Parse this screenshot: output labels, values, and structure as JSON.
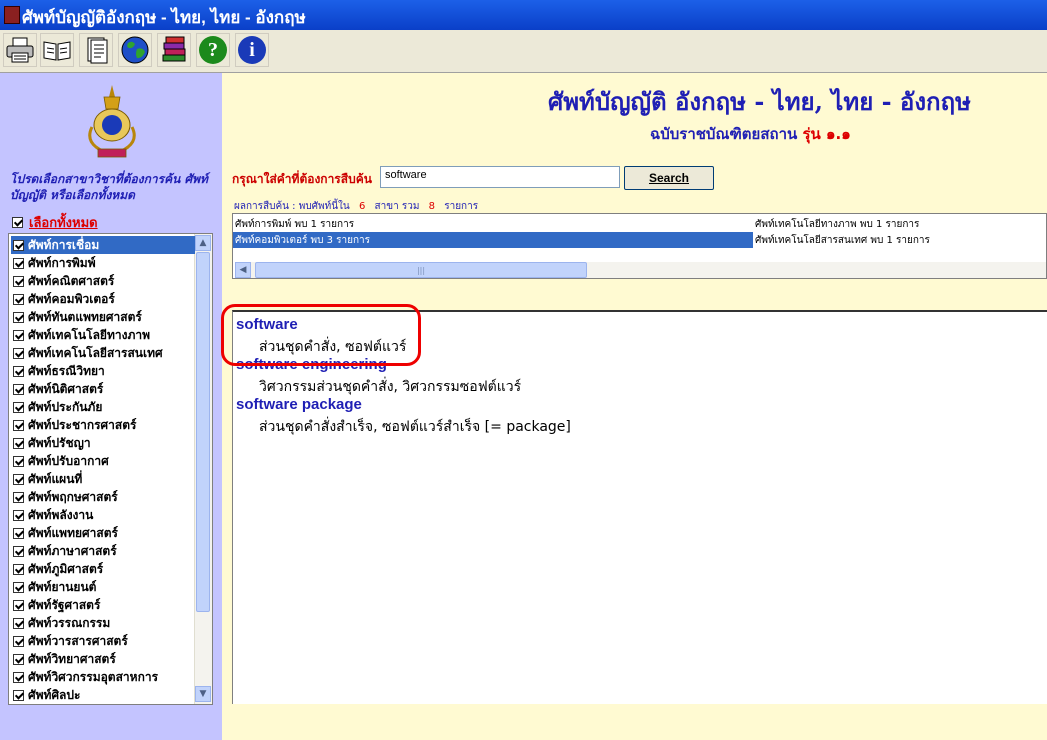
{
  "window": {
    "title": "ศัพท์บัญญัติอังกฤษ - ไทย, ไทย - อังกฤษ"
  },
  "toolbar": {
    "buttons": [
      {
        "icon": "printer-icon"
      },
      {
        "icon": "open-book-icon"
      },
      {
        "icon": "document-icon"
      },
      {
        "icon": "globe-icon"
      },
      {
        "icon": "books-stack-icon"
      },
      {
        "icon": "help-icon",
        "glyph": "?"
      },
      {
        "icon": "info-icon",
        "glyph": "i"
      }
    ]
  },
  "sidebar": {
    "prompt": "โปรดเลือกสาขาวิชาที่ต้องการค้น ศัพท์บัญญัติ หรือเลือกทั้งหมด",
    "select_all_label": "เลือกทั้งหมด",
    "select_all_checked": true,
    "categories": [
      {
        "label": "ศัพท์การเชื่อม",
        "checked": true,
        "selected": true
      },
      {
        "label": "ศัพท์การพิมพ์",
        "checked": true
      },
      {
        "label": "ศัพท์คณิตศาสตร์",
        "checked": true
      },
      {
        "label": "ศัพท์คอมพิวเตอร์",
        "checked": true
      },
      {
        "label": "ศัพท์ทันตแพทยศาสตร์",
        "checked": true
      },
      {
        "label": "ศัพท์เทคโนโลยีทางภาพ",
        "checked": true
      },
      {
        "label": "ศัพท์เทคโนโลยีสารสนเทศ",
        "checked": true
      },
      {
        "label": "ศัพท์ธรณีวิทยา",
        "checked": true
      },
      {
        "label": "ศัพท์นิติศาสตร์",
        "checked": true
      },
      {
        "label": "ศัพท์ประกันภัย",
        "checked": true
      },
      {
        "label": "ศัพท์ประชากรศาสตร์",
        "checked": true
      },
      {
        "label": "ศัพท์ปรัชญา",
        "checked": true
      },
      {
        "label": "ศัพท์ปรับอากาศ",
        "checked": true
      },
      {
        "label": "ศัพท์แผนที่",
        "checked": true
      },
      {
        "label": "ศัพท์พฤกษศาสตร์",
        "checked": true
      },
      {
        "label": "ศัพท์พลังงาน",
        "checked": true
      },
      {
        "label": "ศัพท์แพทยศาสตร์",
        "checked": true
      },
      {
        "label": "ศัพท์ภาษาศาสตร์",
        "checked": true
      },
      {
        "label": "ศัพท์ภูมิศาสตร์",
        "checked": true
      },
      {
        "label": "ศัพท์ยานยนต์",
        "checked": true
      },
      {
        "label": "ศัพท์รัฐศาสตร์",
        "checked": true
      },
      {
        "label": "ศัพท์วรรณกรรม",
        "checked": true
      },
      {
        "label": "ศัพท์วารสารศาสตร์",
        "checked": true
      },
      {
        "label": "ศัพท์วิทยาศาสตร์",
        "checked": true
      },
      {
        "label": "ศัพท์วิศวกรรมอุตสาหการ",
        "checked": true
      },
      {
        "label": "ศัพท์ศิลปะ",
        "checked": true
      }
    ]
  },
  "header": {
    "title": "ศัพท์บัญญัติ อังกฤษ - ไทย, ไทย - อังกฤษ",
    "subtitle": "ฉบับราชบัณฑิตยสถาน",
    "version_label": "รุ่น ๑.๑"
  },
  "search": {
    "label": "กรุณาใส่คำที่ต้องการสืบค้น",
    "value": "software",
    "button_label": "Search"
  },
  "summary": {
    "prefix": "ผลการสืบค้น : พบศัพท์นี้ใน",
    "branch_count": "6",
    "branch_label": "สาขา  รวม",
    "total_count": "8",
    "total_label": "รายการ"
  },
  "results": {
    "col1": [
      {
        "text": "ศัพท์การพิมพ์ พบ 1 รายการ",
        "selected": false
      },
      {
        "text": "ศัพท์คอมพิวเตอร์ พบ 3 รายการ",
        "selected": true
      }
    ],
    "col2": [
      {
        "text": "ศัพท์เทคโนโลยีทางภาพ พบ 1 รายการ"
      },
      {
        "text": "ศัพท์เทคโนโลยีสารสนเทศ พบ 1 รายการ"
      }
    ]
  },
  "definitions": [
    {
      "term": "software",
      "meaning": "ส่วนชุดคำสั่ง, ซอฟต์แวร์"
    },
    {
      "term": "software engineering",
      "meaning": "วิศวกรรมส่วนชุดคำสั่ง, วิศวกรรมซอฟต์แวร์"
    },
    {
      "term": "software package",
      "meaning": "ส่วนชุดคำสั่งสำเร็จ, ซอฟต์แวร์สำเร็จ [= package]"
    }
  ],
  "colors": {
    "title_bar": "#0a3fc8",
    "sidebar": "#c4c4ff",
    "main_bg": "#fffad2",
    "accent_blue": "#1f1fb4",
    "accent_red": "#dd0000",
    "selection": "#316ac5"
  }
}
